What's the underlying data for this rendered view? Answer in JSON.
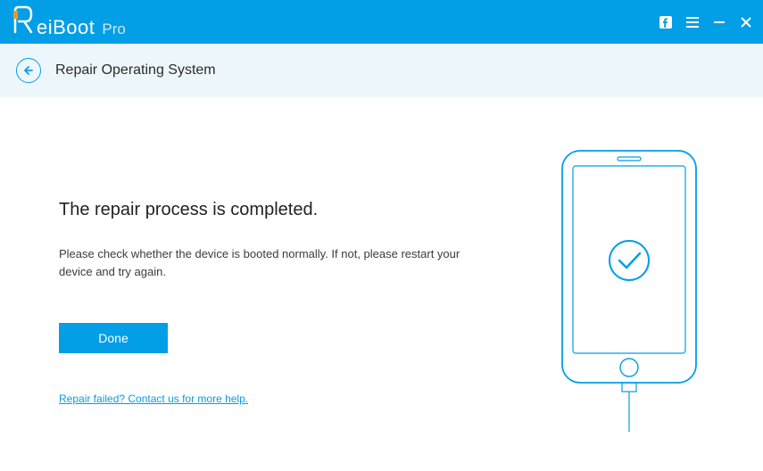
{
  "app": {
    "name": "eiBoot",
    "edition": "Pro"
  },
  "subheader": {
    "title": "Repair Operating System"
  },
  "main": {
    "heading": "The repair process is completed.",
    "description": "Please check whether the device is booted normally. If not, please restart your device and try again.",
    "done_label": "Done",
    "help_link": "Repair failed? Contact us for more help."
  },
  "icons": {
    "facebook": "facebook-icon",
    "menu": "menu-icon",
    "minimize": "minimize-icon",
    "close": "close-icon",
    "back": "back-icon",
    "phone_check": "phone-checkmark-icon"
  },
  "colors": {
    "primary": "#029ee6",
    "subheader_bg": "#edf7fb"
  }
}
